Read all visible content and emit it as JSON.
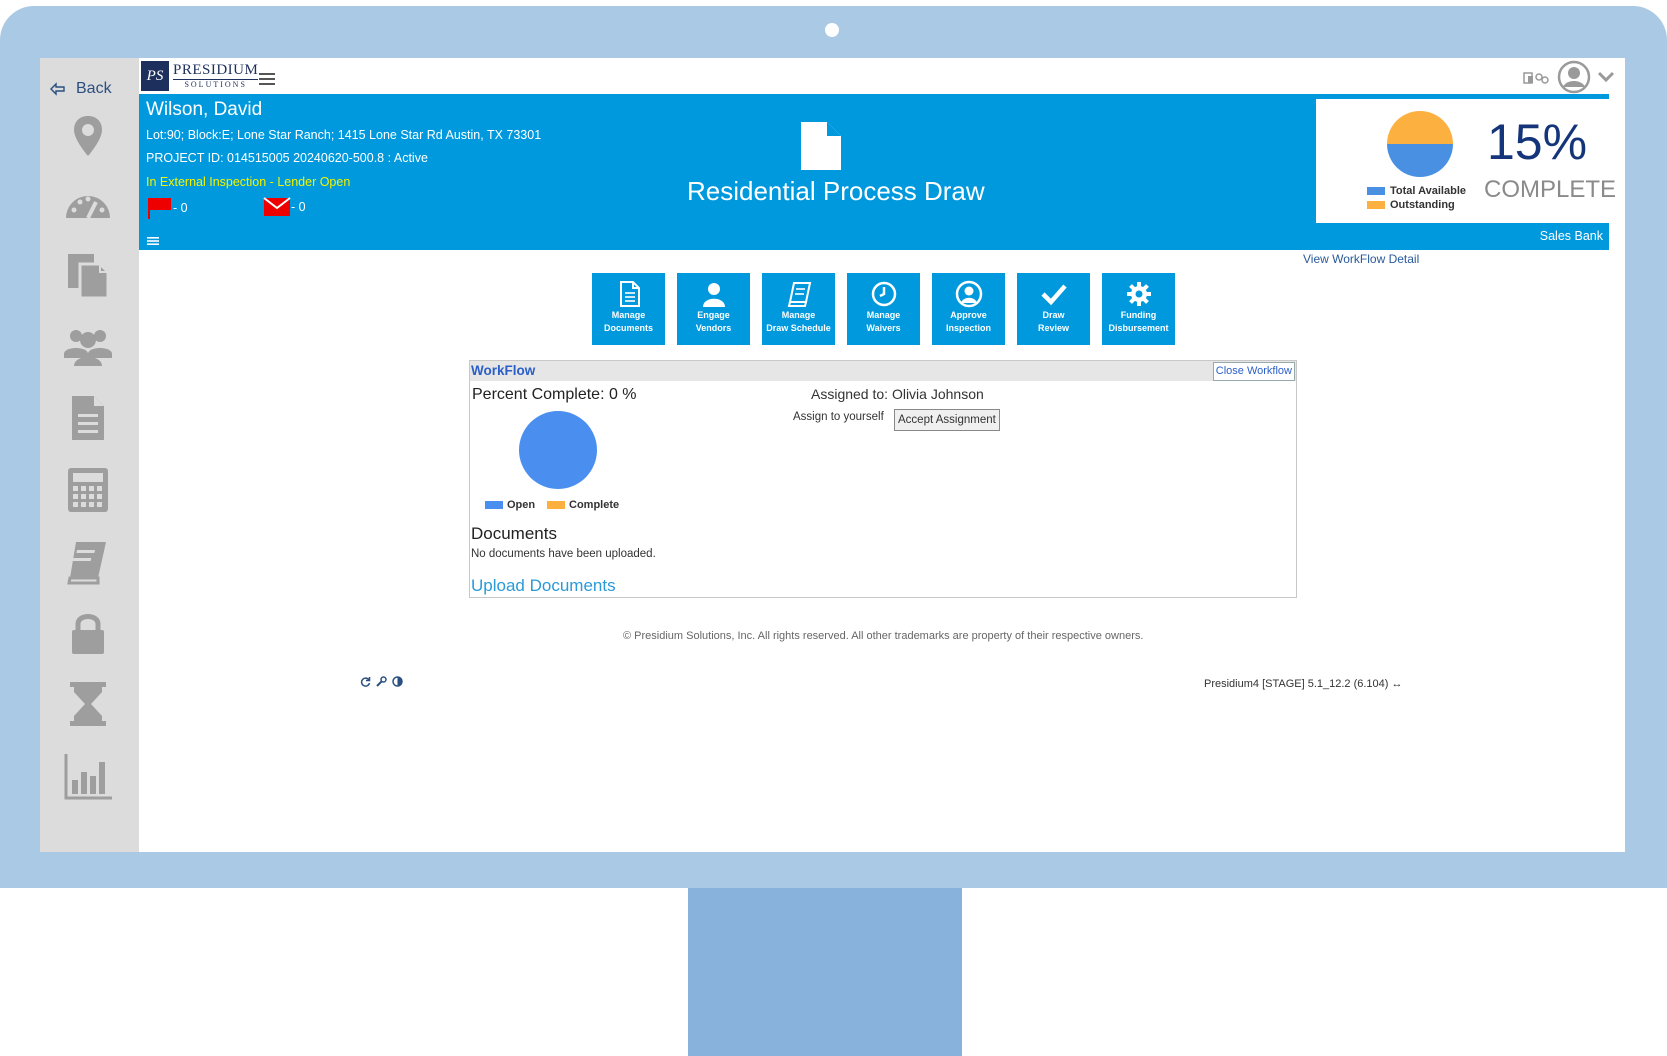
{
  "sidebar": {
    "back_label": "Back",
    "icons": [
      "location-icon",
      "dashboard-icon",
      "documents-icon",
      "users-icon",
      "file-icon",
      "calculator-icon",
      "book-icon",
      "lock-icon",
      "hourglass-icon",
      "chart-icon"
    ]
  },
  "logo": {
    "main": "PRESIDIUM",
    "sub": "SOLUTIONS",
    "badge": "PS"
  },
  "banner": {
    "name": "Wilson, David",
    "address": "Lot:90; Block:E; Lone Star Ranch; 1415 Lone Star Rd Austin, TX 73301",
    "project": "PROJECT ID: 014515005 20240620-500.8 : Active",
    "status": "In External Inspection - Lender Open",
    "flag_count": "- 0",
    "mail_count": "- 0",
    "title": "Residential Process Draw",
    "bank": "Sales Bank",
    "accent": "#0099dd"
  },
  "completion": {
    "percent": "15%",
    "percent_value": 15,
    "label": "COMPLETE",
    "legend_total": "Total Available",
    "legend_outstanding": "Outstanding",
    "colors": {
      "total": "#4a90e2",
      "outstanding": "#fbb040"
    }
  },
  "view_workflow": "View WorkFlow Detail",
  "actions": [
    {
      "line1": "Manage",
      "line2": "Documents",
      "icon": "document-icon"
    },
    {
      "line1": "Engage",
      "line2": "Vendors",
      "icon": "user-icon"
    },
    {
      "line1": "Manage",
      "line2": "Draw Schedule",
      "icon": "book-icon"
    },
    {
      "line1": "Manage",
      "line2": "Waivers",
      "icon": "clock-icon"
    },
    {
      "line1": "Approve",
      "line2": "Inspection",
      "icon": "user-circle-icon"
    },
    {
      "line1": "Draw",
      "line2": "Review",
      "icon": "check-icon"
    },
    {
      "line1": "Funding",
      "line2": "Disbursement",
      "icon": "gear-icon"
    }
  ],
  "workflow": {
    "title": "WorkFlow",
    "close": "Close Workflow",
    "percent_complete": "Percent Complete: 0 %",
    "percent_complete_value": 0,
    "assigned_to": "Assigned to: Olivia Johnson",
    "assign_self": "Assign to yourself",
    "accept": "Accept Assignment",
    "legend_open": "Open",
    "legend_complete": "Complete",
    "documents_heading": "Documents",
    "no_documents": "No documents have been uploaded.",
    "upload": "Upload Documents"
  },
  "footer": {
    "copyright": "© Presidium Solutions, Inc. All rights reserved. All other trademarks are property of their respective owners.",
    "version": "Presidium4 [STAGE] 5.1_12.2 (6.104) ↔",
    "tools": [
      "refresh-icon",
      "wrench-icon",
      "contrast-icon"
    ]
  }
}
